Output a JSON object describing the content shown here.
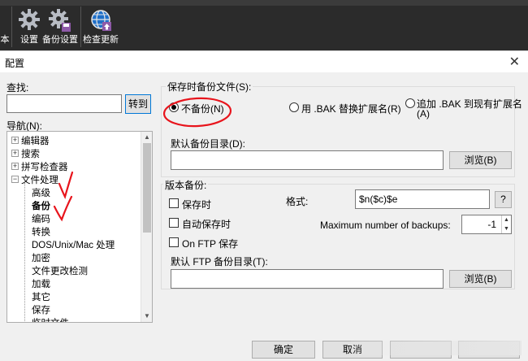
{
  "toolbar": {
    "buttons": [
      {
        "label": "本",
        "icon": "partial-icon"
      },
      {
        "label": "设置",
        "icon": "gear-icon"
      },
      {
        "label": "备份设置",
        "icon": "gear-save-icon"
      },
      {
        "label": "检查更新",
        "icon": "globe-update-icon"
      }
    ]
  },
  "dialog": {
    "title": "配置",
    "close_glyph": "✕",
    "search_label": "查找:",
    "search_value": "",
    "goto_button": "转到",
    "nav_label": "导航(N):",
    "tree": {
      "items": [
        {
          "label": "编辑器",
          "expandable": true
        },
        {
          "label": "搜索",
          "expandable": true
        },
        {
          "label": "拼写检查器",
          "expandable": true
        },
        {
          "label": "文件处理",
          "expandable": true,
          "expanded": true
        },
        {
          "label": "高级"
        },
        {
          "label": "备份",
          "selected": true
        },
        {
          "label": "编码"
        },
        {
          "label": "转换"
        },
        {
          "label": "DOS/Unix/Mac 处理"
        },
        {
          "label": "加密"
        },
        {
          "label": "文件更改检测"
        },
        {
          "label": "加载"
        },
        {
          "label": "其它"
        },
        {
          "label": "保存"
        },
        {
          "label": "临时文件"
        }
      ],
      "scroll_up": "▲",
      "scroll_down": "▼"
    },
    "save_backup": {
      "title": "保存时备份文件(S):",
      "options": [
        {
          "label": "不备份(N)",
          "checked": true
        },
        {
          "label": "用 .BAK 替换扩展名(R)",
          "checked": false
        },
        {
          "label": "追加 .BAK 到现有扩展名",
          "label2": "(A)",
          "checked": false
        }
      ],
      "default_dir_label": "默认备份目录(D):",
      "default_dir_value": "",
      "browse": "浏览(B)"
    },
    "version_backup": {
      "title": "版本备份:",
      "on_save": "保存时",
      "auto_save": "自动保存时",
      "on_ftp": "On FTP 保存",
      "format_label": "格式:",
      "format_value": "$n($c)$e",
      "help": "?",
      "max_label": "Maximum number of backups:",
      "max_value": "-1",
      "ftp_dir_label": "默认 FTP 备份目录(T):",
      "ftp_dir_value": "",
      "browse": "浏览(B)",
      "spin_up": "▲",
      "spin_down": "▼"
    },
    "buttons": {
      "ok": "确定",
      "cancel": "取消"
    }
  },
  "colors": {
    "annotation_red": "#e8141c",
    "toolbar_bg": "#2b2b2b"
  }
}
